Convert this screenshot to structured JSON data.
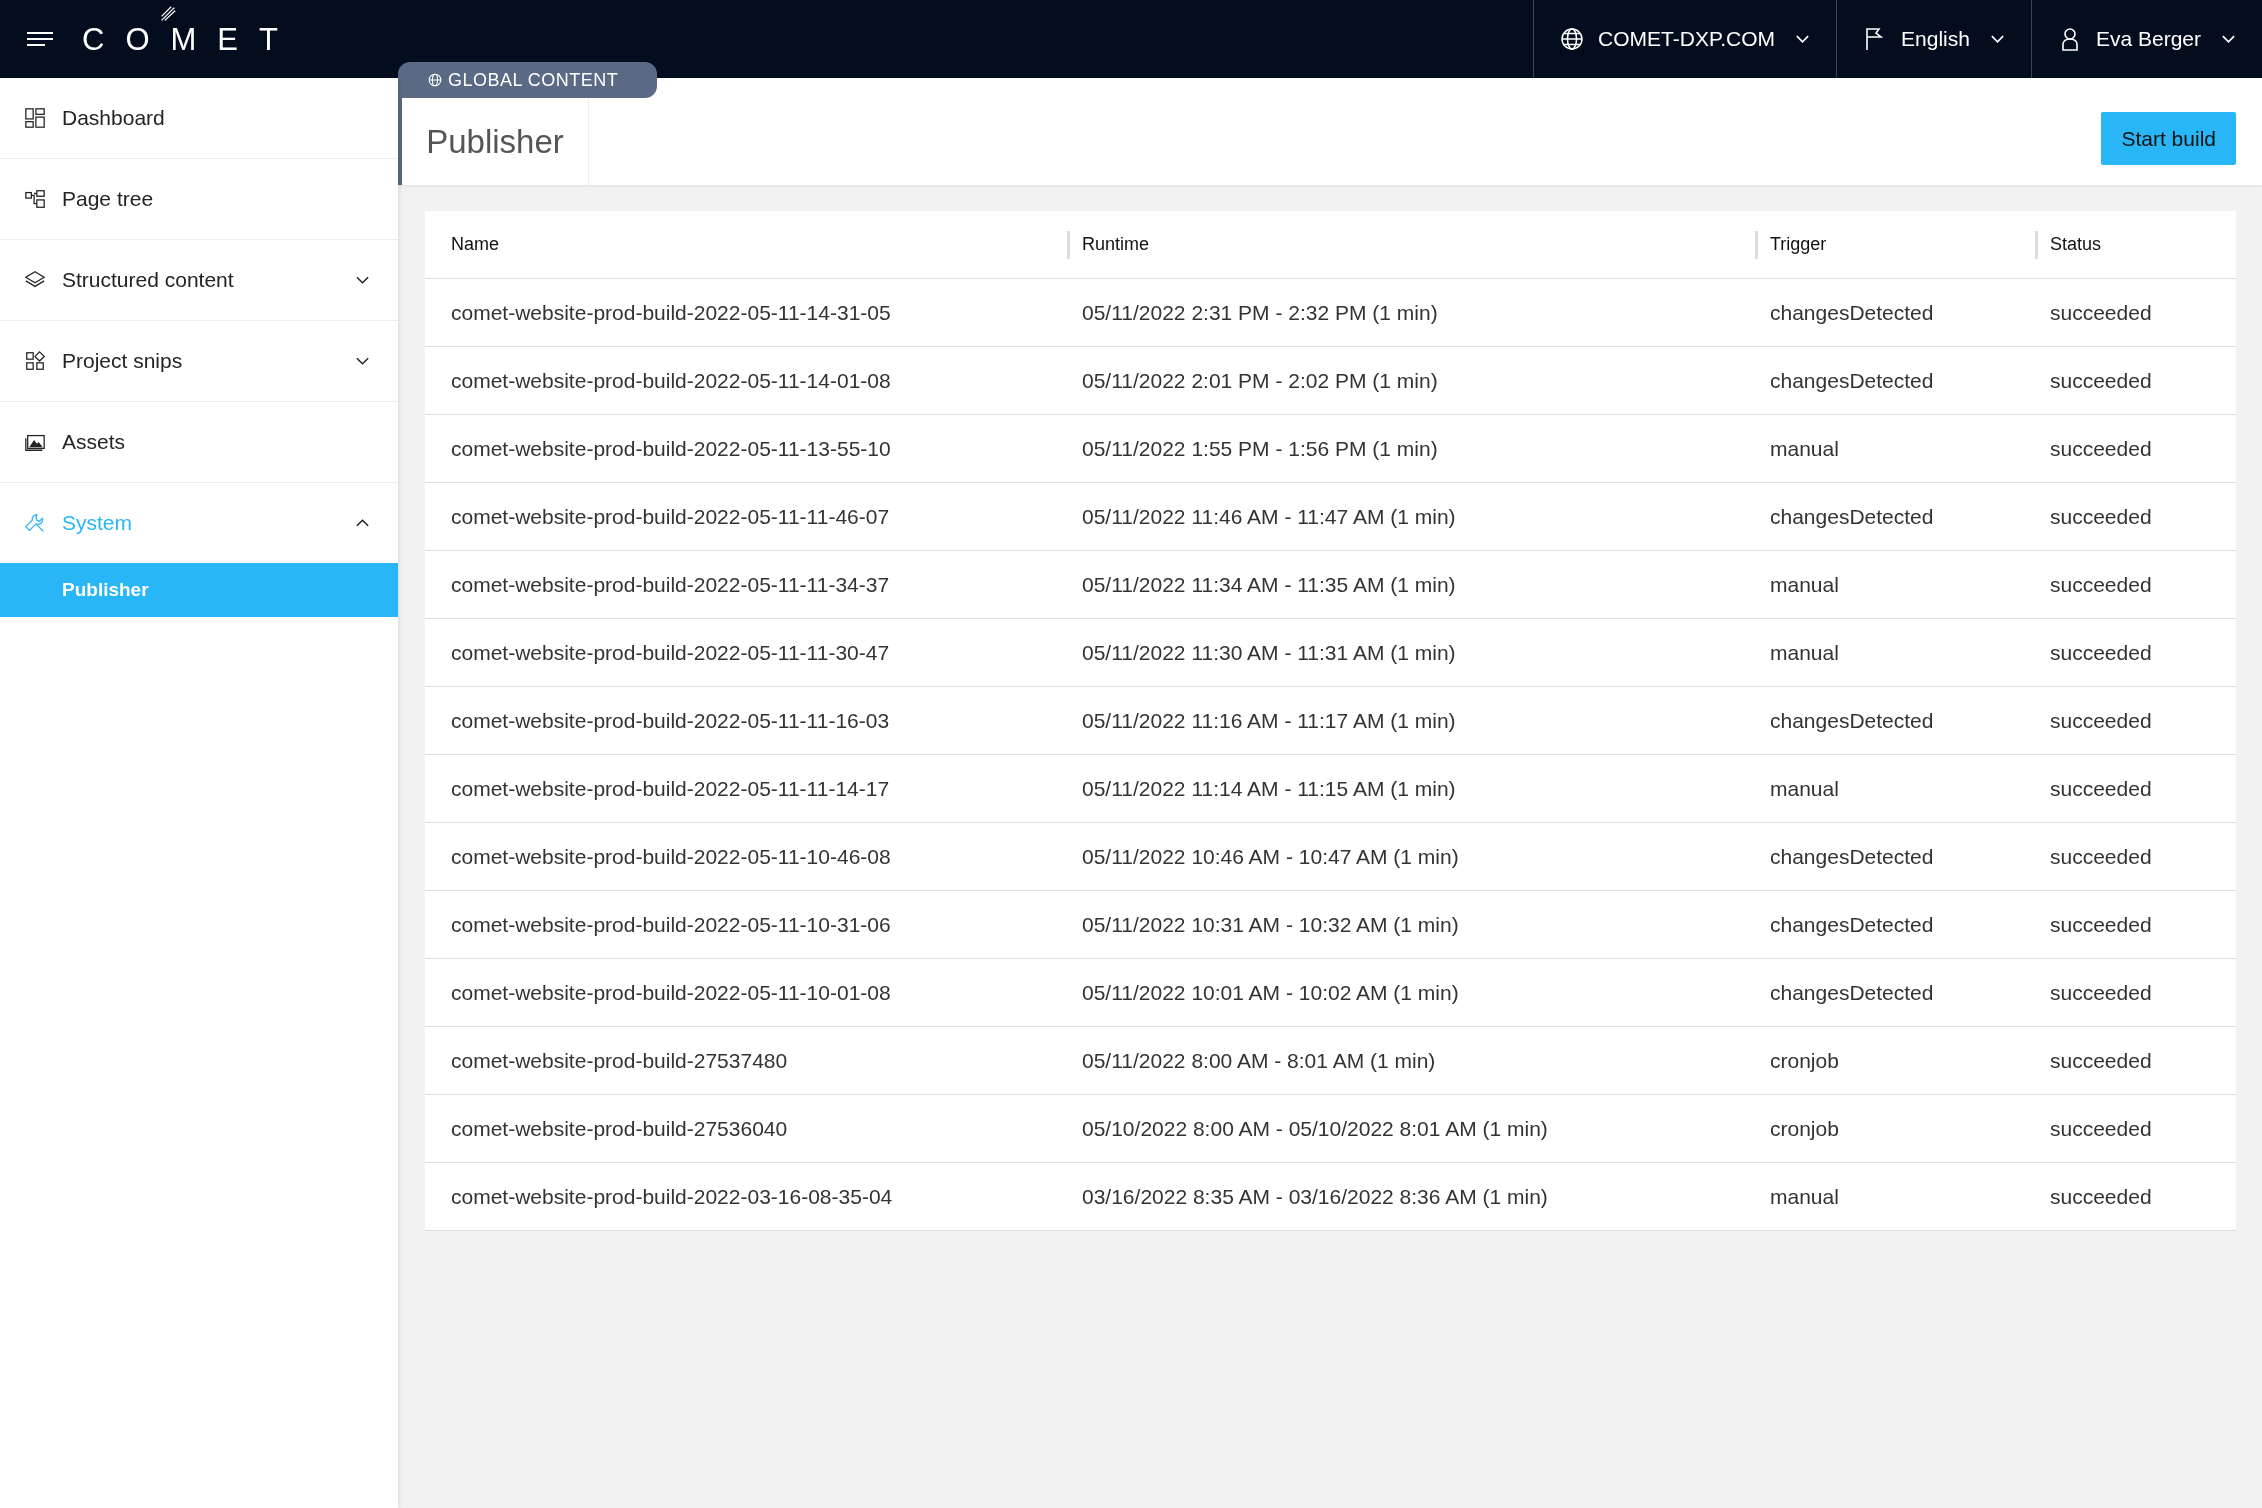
{
  "top_bar": {
    "logo": "COMET",
    "domain": "COMET-DXP.COM",
    "language": "English",
    "user": "Eva Berger"
  },
  "sidebar": {
    "items": [
      {
        "label": "Dashboard",
        "kind": "dashboard",
        "selected": false
      },
      {
        "label": "Page tree",
        "kind": "tree",
        "selected": false
      },
      {
        "label": "Structured content",
        "kind": "layers",
        "selected": false,
        "expanded": false
      },
      {
        "label": "Project snips",
        "kind": "snips",
        "selected": false,
        "expanded": false
      },
      {
        "label": "Assets",
        "kind": "assets",
        "selected": false
      },
      {
        "label": "System",
        "kind": "wrench",
        "selected": true,
        "expanded": true,
        "children": [
          {
            "label": "Publisher",
            "selected": true
          }
        ]
      }
    ]
  },
  "scope_tab": "GLOBAL CONTENT",
  "page_title": "Publisher",
  "start_button": "Start build",
  "table": {
    "columns": [
      "Name",
      "Runtime",
      "Trigger",
      "Status"
    ],
    "rows": [
      [
        "comet-website-prod-build-2022-05-11-14-31-05",
        "05/11/2022 2:31 PM - 2:32 PM (1 min)",
        "changesDetected",
        "succeeded"
      ],
      [
        "comet-website-prod-build-2022-05-11-14-01-08",
        "05/11/2022 2:01 PM - 2:02 PM (1 min)",
        "changesDetected",
        "succeeded"
      ],
      [
        "comet-website-prod-build-2022-05-11-13-55-10",
        "05/11/2022 1:55 PM - 1:56 PM (1 min)",
        "manual",
        "succeeded"
      ],
      [
        "comet-website-prod-build-2022-05-11-11-46-07",
        "05/11/2022 11:46 AM - 11:47 AM (1 min)",
        "changesDetected",
        "succeeded"
      ],
      [
        "comet-website-prod-build-2022-05-11-11-34-37",
        "05/11/2022 11:34 AM - 11:35 AM (1 min)",
        "manual",
        "succeeded"
      ],
      [
        "comet-website-prod-build-2022-05-11-11-30-47",
        "05/11/2022 11:30 AM - 11:31 AM (1 min)",
        "manual",
        "succeeded"
      ],
      [
        "comet-website-prod-build-2022-05-11-11-16-03",
        "05/11/2022 11:16 AM - 11:17 AM (1 min)",
        "changesDetected",
        "succeeded"
      ],
      [
        "comet-website-prod-build-2022-05-11-11-14-17",
        "05/11/2022 11:14 AM - 11:15 AM (1 min)",
        "manual",
        "succeeded"
      ],
      [
        "comet-website-prod-build-2022-05-11-10-46-08",
        "05/11/2022 10:46 AM - 10:47 AM (1 min)",
        "changesDetected",
        "succeeded"
      ],
      [
        "comet-website-prod-build-2022-05-11-10-31-06",
        "05/11/2022 10:31 AM - 10:32 AM (1 min)",
        "changesDetected",
        "succeeded"
      ],
      [
        "comet-website-prod-build-2022-05-11-10-01-08",
        "05/11/2022 10:01 AM - 10:02 AM (1 min)",
        "changesDetected",
        "succeeded"
      ],
      [
        "comet-website-prod-build-27537480",
        "05/11/2022 8:00 AM - 8:01 AM (1 min)",
        "cronjob",
        "succeeded"
      ],
      [
        "comet-website-prod-build-27536040",
        "05/10/2022 8:00 AM - 05/10/2022 8:01 AM (1 min)",
        "cronjob",
        "succeeded"
      ],
      [
        "comet-website-prod-build-2022-03-16-08-35-04",
        "03/16/2022 8:35 AM - 03/16/2022 8:36 AM (1 min)",
        "manual",
        "succeeded"
      ]
    ]
  }
}
